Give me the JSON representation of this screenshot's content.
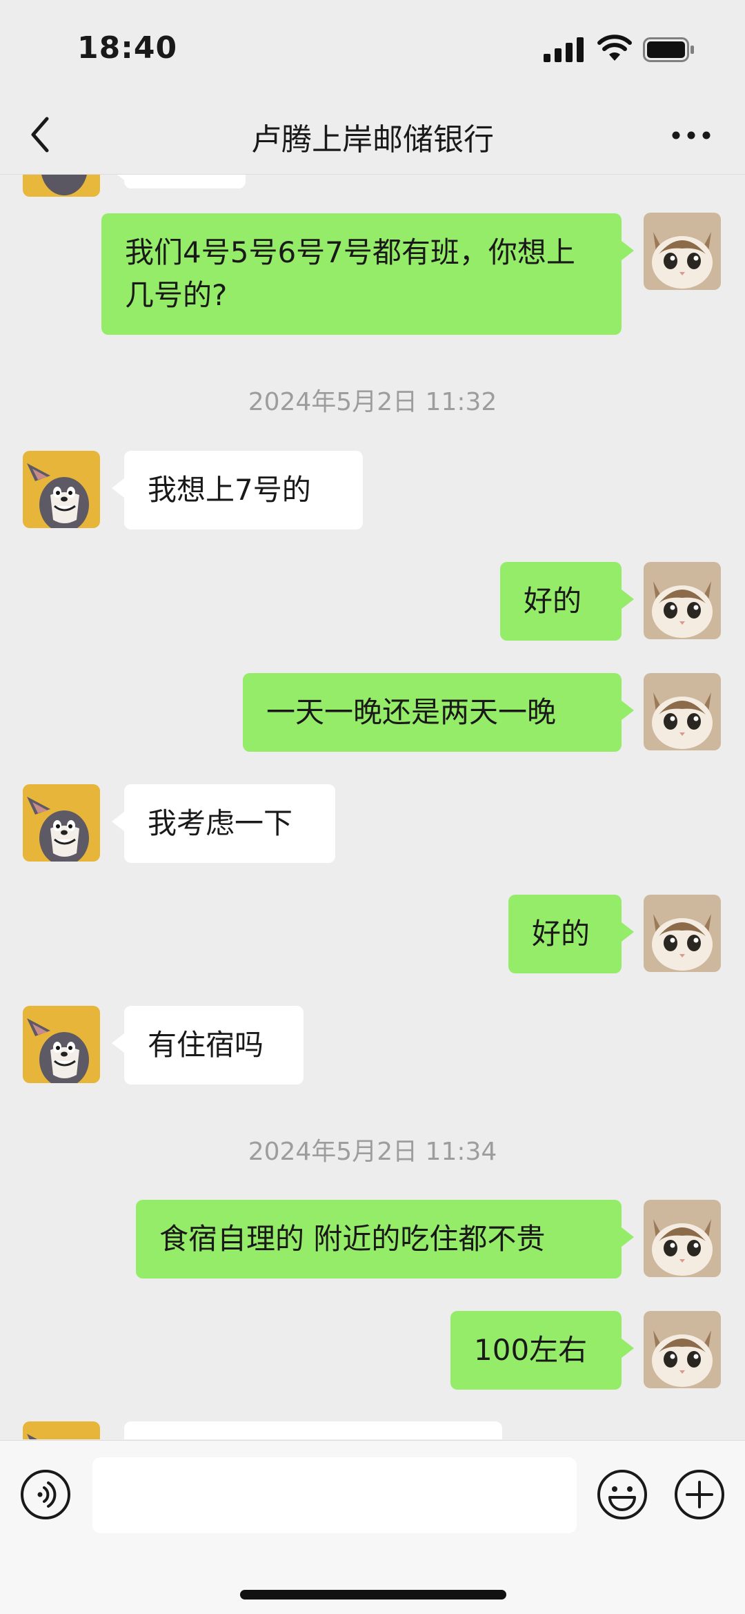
{
  "status": {
    "time": "18:40"
  },
  "nav": {
    "title": "卢腾上岸邮储银行"
  },
  "icons": {
    "back": "chevron-left-icon",
    "more": "more-dots-icon",
    "voice": "voice-icon",
    "emoji": "emoji-icon",
    "plus": "plus-icon",
    "cat_avatar": "cat-avatar",
    "tom_avatar": "tom-cat-avatar"
  },
  "colors": {
    "outgoing_bubble": "#95ec69",
    "incoming_bubble": "#ffffff",
    "background": "#ededed"
  },
  "messages": [
    {
      "type": "out",
      "text": "我们4号5号6号7号都有班，你想上几号的?"
    },
    {
      "type": "time",
      "text": "2024年5月2日 11:32"
    },
    {
      "type": "in",
      "text": "我想上7号的"
    },
    {
      "type": "out",
      "text": "好的"
    },
    {
      "type": "out",
      "text": "一天一晚还是两天一晚"
    },
    {
      "type": "in",
      "text": "我考虑一下"
    },
    {
      "type": "out",
      "text": "好的"
    },
    {
      "type": "in",
      "text": "有住宿吗"
    },
    {
      "type": "time",
      "text": "2024年5月2日 11:34"
    },
    {
      "type": "out",
      "text": "食宿自理的 附近的吃住都不贵"
    },
    {
      "type": "out",
      "text": "100左右"
    }
  ],
  "input": {
    "value": ""
  }
}
